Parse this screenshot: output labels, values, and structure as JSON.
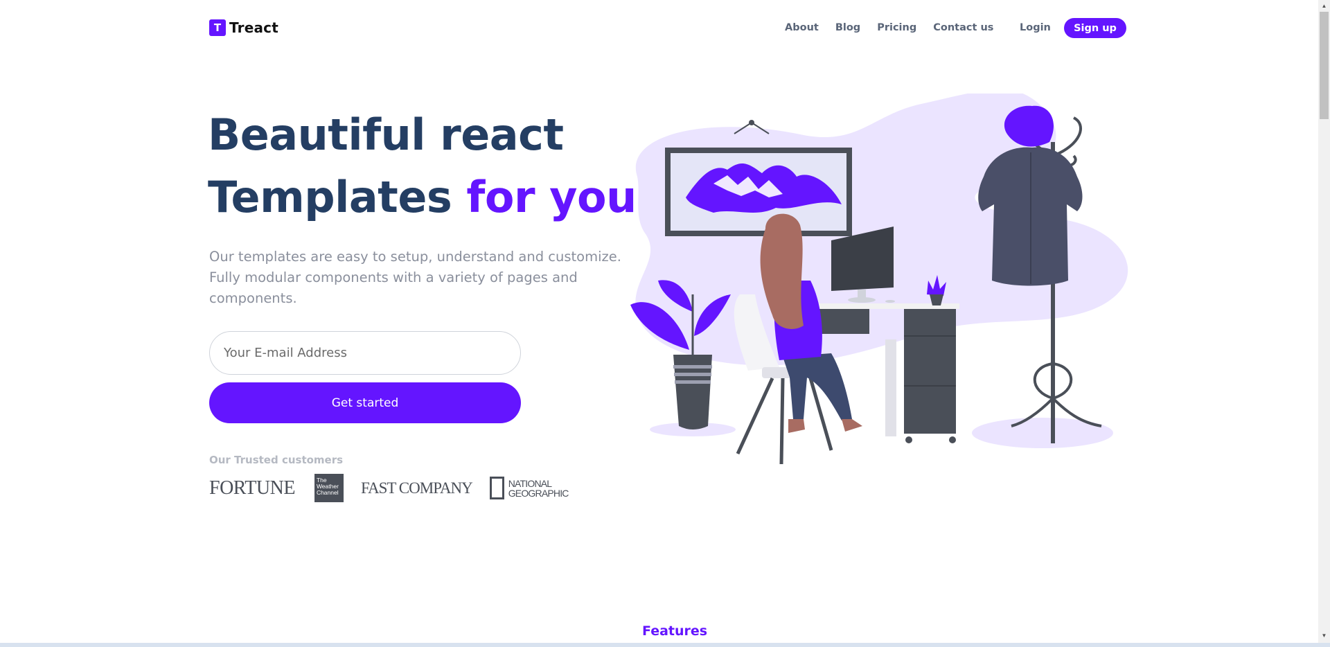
{
  "header": {
    "logo_letter": "T",
    "brand": "Treact",
    "nav": [
      "About",
      "Blog",
      "Pricing",
      "Contact us"
    ],
    "login": "Login",
    "signup": "Sign up"
  },
  "hero": {
    "title_line1": "Beautiful react",
    "title_line2_main": "Templates",
    "title_line2_accent": "for you",
    "description": "Our templates are easy to setup, understand and customize. Fully modular components with a variety of pages and components.",
    "email_placeholder": "Your E-mail Address",
    "cta": "Get started"
  },
  "trusted": {
    "label": "Our Trusted customers",
    "logos": {
      "fortune": "FORTUNE",
      "weather": [
        "The",
        "Weather",
        "Channel"
      ],
      "fastcompany": "FAST COMPANY",
      "natgeo": [
        "NATIONAL",
        "GEOGRAPHIC"
      ]
    }
  },
  "features_label": "Features",
  "colors": {
    "primary": "#6415ff",
    "heading": "#243e63",
    "blob": "#ebe4ff"
  }
}
